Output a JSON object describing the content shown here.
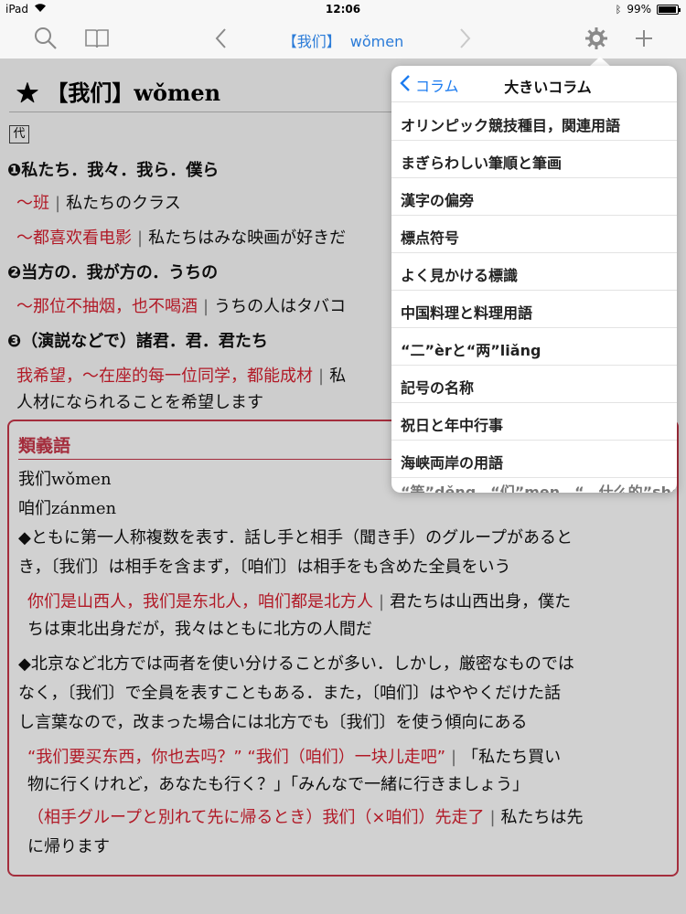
{
  "status_bar": {
    "device": "iPad",
    "time": "12:06",
    "battery": "99%"
  },
  "toolbar": {
    "title_headword": "【我们】",
    "title_pinyin": "wǒmen",
    "icons": [
      "search-icon",
      "book-icon",
      "chevron-left-icon",
      "chevron-right-icon",
      "gear-icon",
      "plus-icon"
    ]
  },
  "entry": {
    "headword": "★ 【我们】wǒmen",
    "pos": "代",
    "sense1": "❶私たち．我々．我ら．僕ら",
    "ex1_cn": "～班",
    "ex1_jp": "私たちのクラス",
    "ex2_cn": "～都喜欢看电影",
    "ex2_jp": "私たちはみな映画が好きだ",
    "sense2": "❷当方の．我が方の．うちの",
    "ex3_cn": "～那位不抽烟，也不喝酒",
    "ex3_jp": "うちの人はタバコ",
    "sense3": "❸（演説などで）諸君．君．君たち",
    "ex4_cn": "我希望，～在座的每一位同学，都能成材",
    "ex4_jp_a": "私",
    "ex4_jp_b": "人材になられることを希望します"
  },
  "synonyms": {
    "title": "類義語",
    "word1": "我们wǒmen",
    "word2": "咱们zánmen",
    "note1_a": "◆ともに第一人称複数を表す．話し手と相手（聞き手）のグループがあると",
    "note1_b": "き，〔我们〕は相手を含まず，〔咱们〕は相手をも含めた全員をいう",
    "ex1_cn": "你们是山西人，我们是东北人，咱们都是北方人",
    "ex1_jp_a": "君たちは山西出身，僕た",
    "ex1_jp_b": "ちは東北出身だが，我々はともに北方の人間だ",
    "note2_a": "◆北京など北方では両者を使い分けることが多い．しかし，厳密なものでは",
    "note2_b": "なく，〔我们〕で全員を表すこともある．また，〔咱们〕はややくだけた話",
    "note2_c": "し言葉なので，改まった場合には北方でも〔我们〕を使う傾向にある",
    "ex2_cn": "“我们要买东西，你也去吗？” “我们（咱们）一块儿走吧”",
    "ex2_jp_a": "「私たち買い",
    "ex2_jp_b": "物に行くけれど，あなたも行く？」「みんなで一緒に行きましょう」",
    "ex3_cn": "（相手グループと別れて先に帰るとき）我们（×咱们）先走了",
    "ex3_jp_a": "私たちは先",
    "ex3_jp_b": "に帰ります"
  },
  "popover": {
    "back_label": "コラム",
    "title": "大きいコラム",
    "items": [
      "オリンピック競技種目，関連用語",
      "まぎらわしい筆順と筆画",
      "漢字の偏旁",
      "標点符号",
      "よく見かける標識",
      "中国料理と料理用語",
      "“二”èrと“两”liǎng",
      "記号の名称",
      "祝日と年中行事",
      "海峡両岸の用語"
    ],
    "partial_item": "“等”děng，“们”men，“…什么的”shénmede"
  },
  "colors": {
    "accent_blue": "#1c7cf0",
    "example_red": "#d81f2f",
    "synonym_border": "#c8374a"
  }
}
